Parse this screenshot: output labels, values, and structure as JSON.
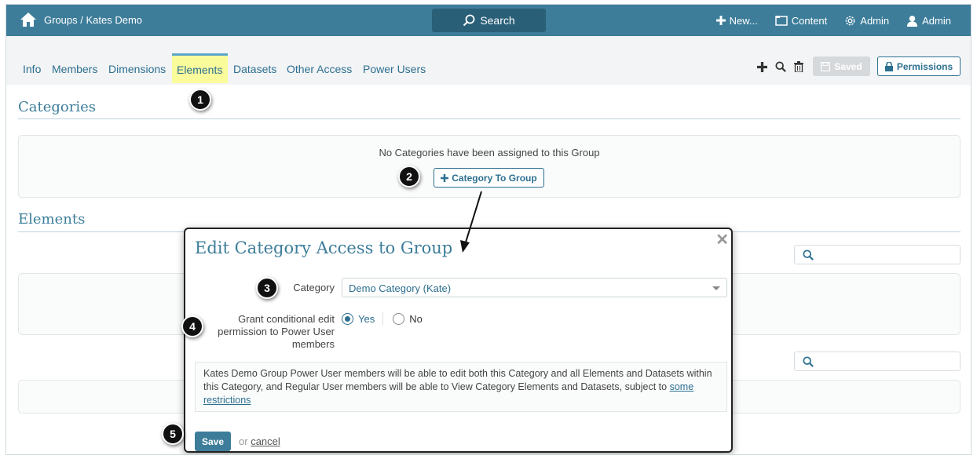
{
  "topbar": {
    "breadcrumb": "Groups / Kates Demo",
    "search_label": "Search",
    "new_label": "New...",
    "content_label": "Content",
    "admin_settings_label": "Admin",
    "user_label": "Admin"
  },
  "tabs": [
    {
      "label": "Info"
    },
    {
      "label": "Members"
    },
    {
      "label": "Dimensions"
    },
    {
      "label": "Elements",
      "active": true
    },
    {
      "label": "Datasets"
    },
    {
      "label": "Other Access"
    },
    {
      "label": "Power Users"
    }
  ],
  "toolbar": {
    "saved_label": "Saved",
    "permissions_label": "Permissions"
  },
  "categories": {
    "title": "Categories",
    "empty_text": "No Categories have been assigned to this Group",
    "add_button_label": "Category To Group"
  },
  "elements": {
    "title": "Elements"
  },
  "modal": {
    "title": "Edit Category Access to Group",
    "category_label": "Category",
    "category_value": "Demo Category (Kate)",
    "grant_label_line1": "Grant conditional edit",
    "grant_label_line2": "permission to Power User",
    "grant_label_line3": "members",
    "option_yes": "Yes",
    "option_no": "No",
    "selected_option": "Yes",
    "note_text": "Kates Demo Group Power User members will be able to edit both this Category and all Elements and Datasets within this Category, and Regular User members will be able to View Category Elements and Datasets, subject to",
    "note_link": "some restrictions",
    "save_label": "Save",
    "or_text": "or",
    "cancel_label": "cancel"
  },
  "callouts": [
    "1",
    "2",
    "3",
    "4",
    "5"
  ],
  "colors": {
    "topbar": "#3d7d9a",
    "accent": "#2c6f90",
    "active_tab_highlight": "#fafc9c"
  }
}
